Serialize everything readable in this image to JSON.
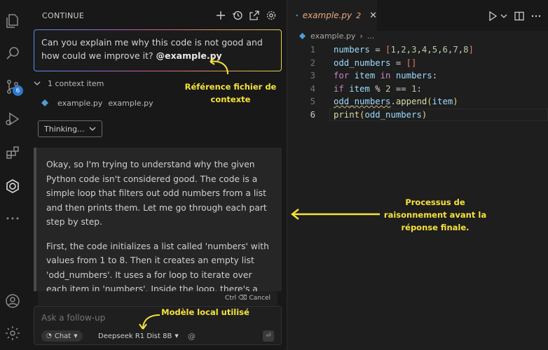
{
  "panel": {
    "title": "CONTINUE",
    "question": "Can you explain me why this code is not good  and how could we improve it?",
    "mention": "@example.py",
    "context_label": "1 context item",
    "context_file": "example.py",
    "context_path": "example.py",
    "thinking_label": "Thinking...",
    "reasoning": [
      "Okay, so I'm trying to understand why the given Python code isn't considered good. The code is a simple loop that filters out odd numbers from a list and then prints them. Let me go through each part step by step.",
      "First, the code initializes a list called 'numbers' with values from 1 to 8. Then it creates an empty list 'odd_numbers'. It uses a for loop to iterate over each item in 'numbers'. Inside the loop, there's a"
    ],
    "cancel_shortcut": "Ctrl ⌫ Cancel",
    "followup_placeholder": "Ask a follow-up",
    "mode": "Chat",
    "model": "Deepseek R1 Dist 8B",
    "at_symbol": "@"
  },
  "activity": {
    "scm_badge": "6"
  },
  "editor": {
    "tab_name": "example.py",
    "tab_problems": "2",
    "breadcrumb_file": "example.py",
    "breadcrumb_more": "...",
    "line_numbers": [
      "1",
      "2",
      "3",
      "4",
      "5",
      "6"
    ],
    "active_line": 6
  },
  "annotations": {
    "context_ref": "Référence fichier de contexte",
    "reasoning_process": "Processus de raisonnement avant la réponse finale.",
    "local_model": "Modèle local utilisé"
  },
  "colors": {
    "annotation": "#f6e33b",
    "accent": "#2b79d0",
    "tab_title": "#e8a87c"
  }
}
